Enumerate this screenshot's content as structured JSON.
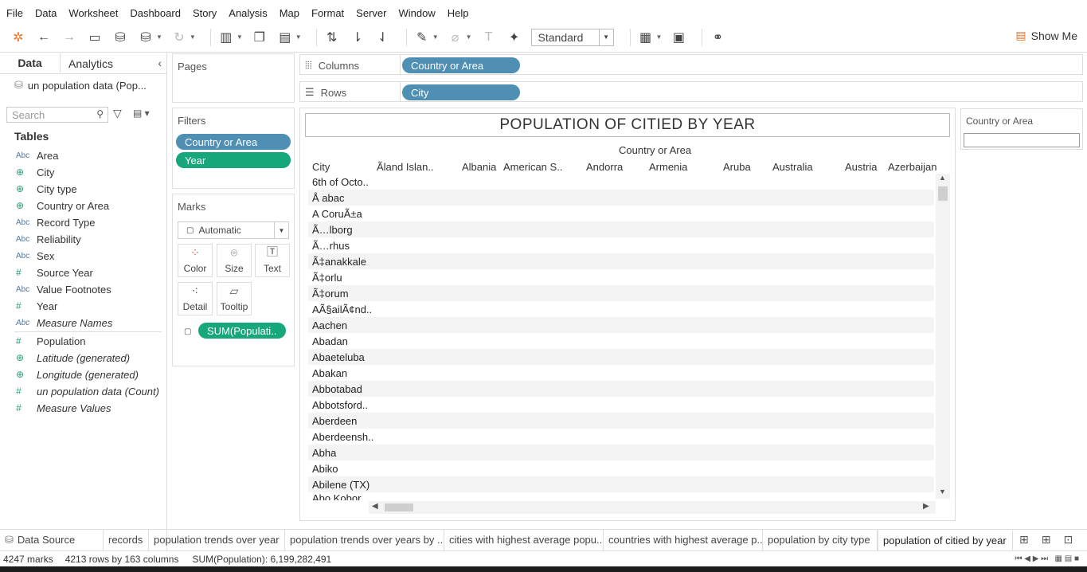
{
  "menu": [
    "File",
    "Data",
    "Worksheet",
    "Dashboard",
    "Story",
    "Analysis",
    "Map",
    "Format",
    "Server",
    "Window",
    "Help"
  ],
  "toolbar": {
    "standard_label": "Standard",
    "show_me_label": "Show Me"
  },
  "left_tabs": {
    "data": "Data",
    "analytics": "Analytics"
  },
  "datasource": "un population data (Pop...",
  "search_placeholder": "Search",
  "tables_heading": "Tables",
  "fields": [
    {
      "type": "Abc",
      "name": "Area"
    },
    {
      "type": "globe",
      "name": "City"
    },
    {
      "type": "globe",
      "name": "City type"
    },
    {
      "type": "globe",
      "name": "Country or Area"
    },
    {
      "type": "Abc",
      "name": "Record Type"
    },
    {
      "type": "Abc",
      "name": "Reliability"
    },
    {
      "type": "Abc",
      "name": "Sex"
    },
    {
      "type": "#",
      "name": "Source Year"
    },
    {
      "type": "Abc",
      "name": "Value Footnotes"
    },
    {
      "type": "#",
      "name": "Year"
    },
    {
      "type": "Abc",
      "name": "Measure Names"
    }
  ],
  "measures": [
    {
      "type": "#",
      "name": "Population"
    },
    {
      "type": "globe",
      "name": "Latitude (generated)"
    },
    {
      "type": "globe",
      "name": "Longitude (generated)"
    },
    {
      "type": "#",
      "name": "un population data (Count)"
    },
    {
      "type": "#",
      "name": "Measure Values"
    }
  ],
  "pages_title": "Pages",
  "filters_title": "Filters",
  "filters": [
    "Country or Area",
    "Year"
  ],
  "marks_title": "Marks",
  "marks_type": "Automatic",
  "mark_buttons": [
    "Color",
    "Size",
    "Text",
    "Detail",
    "Tooltip"
  ],
  "marks_pill": "SUM(Populati..",
  "columns_label": "Columns",
  "columns_pill": "Country or Area",
  "rows_label": "Rows",
  "rows_pill": "City",
  "view_title": "POPULATION OF CITIED BY YEAR",
  "col_group_header": "Country or Area",
  "row_header": "City",
  "col_headers": [
    "Ãland Islan..",
    "Albania",
    "American S..",
    "Andorra",
    "Armenia",
    "Aruba",
    "Australia",
    "Austria",
    "Azerbaijan"
  ],
  "cities": [
    "6th of Octo..",
    "Å abac",
    "A CoruÃ±a",
    "Ã…lborg",
    "Ã…rhus",
    "Ã‡anakkale",
    "Ã‡orlu",
    "Ã‡orum",
    "AÃ§ailÃ¢nd..",
    "Aachen",
    "Abadan",
    "Abaeteluba",
    "Abakan",
    "Abbotabad",
    "Abbotsford..",
    "Aberdeen",
    "Aberdeensh..",
    "Abha",
    "Abiko",
    "Abilene (TX)",
    "Abo Kobor"
  ],
  "filter_card_title": "Country or Area",
  "sheet_tabs": [
    "Data Source",
    "records",
    "population trends over year",
    "population trends over years by ...",
    "cities with highest average popu...",
    "countries with highest average p...",
    "population by city type",
    "population of citied by year"
  ],
  "status": {
    "marks": "4247 marks",
    "rows": "4213 rows by 163 columns",
    "sum": "SUM(Population): 6,199,282,491"
  }
}
